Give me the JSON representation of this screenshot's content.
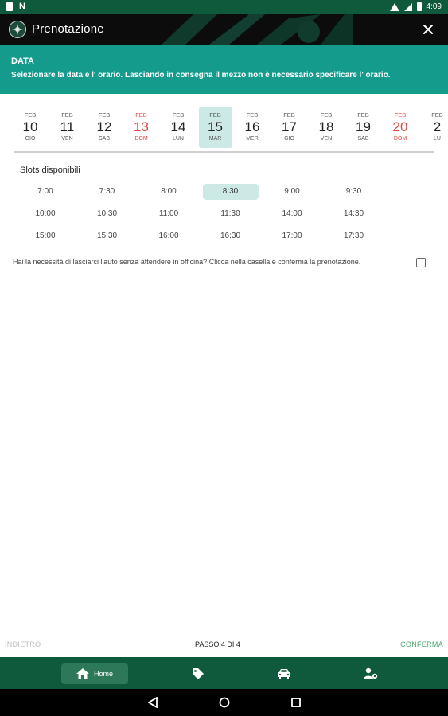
{
  "status_bar": {
    "time": "4:09"
  },
  "app_bar": {
    "title": "Prenotazione",
    "logo_icon": "app-logo",
    "close_icon": "close-icon"
  },
  "info": {
    "heading": "DATA",
    "text": "Selezionare la data e l' orario. Lasciando in consegna il mezzo non è necessario specificare l' orario."
  },
  "dates": [
    {
      "month": "FEB",
      "day": "10",
      "weekday": "GIO",
      "holiday": false,
      "selected": false
    },
    {
      "month": "FEB",
      "day": "11",
      "weekday": "VEN",
      "holiday": false,
      "selected": false
    },
    {
      "month": "FEB",
      "day": "12",
      "weekday": "SAB",
      "holiday": false,
      "selected": false
    },
    {
      "month": "FEB",
      "day": "13",
      "weekday": "DOM",
      "holiday": true,
      "selected": false
    },
    {
      "month": "FEB",
      "day": "14",
      "weekday": "LUN",
      "holiday": false,
      "selected": false
    },
    {
      "month": "FEB",
      "day": "15",
      "weekday": "MAR",
      "holiday": false,
      "selected": true
    },
    {
      "month": "FEB",
      "day": "16",
      "weekday": "MER",
      "holiday": false,
      "selected": false
    },
    {
      "month": "FEB",
      "day": "17",
      "weekday": "GIO",
      "holiday": false,
      "selected": false
    },
    {
      "month": "FEB",
      "day": "18",
      "weekday": "VEN",
      "holiday": false,
      "selected": false
    },
    {
      "month": "FEB",
      "day": "19",
      "weekday": "SAB",
      "holiday": false,
      "selected": false
    },
    {
      "month": "FEB",
      "day": "20",
      "weekday": "DOM",
      "holiday": true,
      "selected": false
    },
    {
      "month": "FEB",
      "day": "2",
      "weekday": "LU",
      "holiday": false,
      "selected": false
    }
  ],
  "slots": {
    "title": "Slots disponibili",
    "times": [
      "7:00",
      "7:30",
      "8:00",
      "8:30",
      "9:00",
      "9:30",
      "10:00",
      "10:30",
      "11:00",
      "11:30",
      "14:00",
      "14:30",
      "15:00",
      "15:30",
      "16:00",
      "16:30",
      "17:00",
      "17:30"
    ],
    "selected": "8:30"
  },
  "leave_car": {
    "text": "Hai la necessità di lasciarci l'auto senza attendere in officina? Clicca nella casella e conferma la prenotazione.",
    "checked": false
  },
  "stepper": {
    "back_label": "INDIETRO",
    "step_label": "PASSO 4 DI 4",
    "confirm_label": "CONFERMA"
  },
  "bottom_nav": {
    "home_label": "Home",
    "items": [
      "home-icon",
      "tag-icon",
      "car-icon",
      "user-settings-icon"
    ]
  },
  "colors": {
    "status_bar": "#0f5a3c",
    "info_banner": "#159b8c",
    "selected_bg": "#cde9e5",
    "holiday": "#e0473f",
    "confirm": "#4aa86d",
    "bottom_nav": "#0f5a3c"
  }
}
